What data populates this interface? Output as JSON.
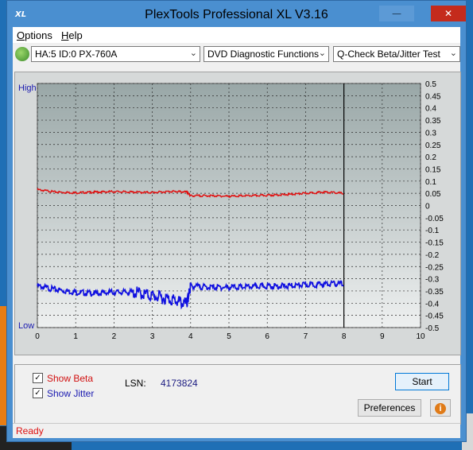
{
  "window": {
    "title": "PlexTools Professional XL V3.16",
    "app_icon_text": "XL"
  },
  "menu": {
    "items": [
      "Options",
      "Help"
    ]
  },
  "toolbar": {
    "drive": "HA:5 ID:0  PX-760A",
    "function": "DVD Diagnostic Functions",
    "test": "Q-Check Beta/Jitter Test"
  },
  "graph": {
    "high_label": "High",
    "low_label": "Low",
    "colors": {
      "plot_top": "#99a7a7",
      "plot_bottom": "#eef0f0",
      "beta": "#e01010",
      "jitter": "#1010e0",
      "grid": "#2a2a2a"
    }
  },
  "chart_data": {
    "type": "line",
    "x_ticks": [
      "0",
      "1",
      "2",
      "3",
      "4",
      "5",
      "6",
      "7",
      "8",
      "9",
      "10"
    ],
    "y_right_ticks": [
      "0.5",
      "0.45",
      "0.4",
      "0.35",
      "0.3",
      "0.25",
      "0.2",
      "0.15",
      "0.1",
      "0.05",
      "0",
      "-0.05",
      "-0.1",
      "-0.15",
      "-0.2",
      "-0.25",
      "-0.3",
      "-0.35",
      "-0.4",
      "-0.45",
      "-0.5"
    ],
    "xlim": [
      0,
      10
    ],
    "ylim": [
      -0.5,
      0.5
    ],
    "grid": true,
    "end_marker_x": 8,
    "series": [
      {
        "color": "#e01010",
        "x": [
          0,
          0.5,
          1,
          1.5,
          2,
          2.5,
          3,
          3.5,
          3.9,
          4.0,
          4.5,
          5,
          5.5,
          6,
          6.5,
          7,
          7.5,
          8
        ],
        "y": [
          0.065,
          0.055,
          0.052,
          0.055,
          0.057,
          0.055,
          0.053,
          0.058,
          0.055,
          0.04,
          0.04,
          0.038,
          0.04,
          0.042,
          0.045,
          0.05,
          0.055,
          0.05
        ]
      },
      {
        "color": "#1010e0",
        "x": [
          0,
          0.5,
          1,
          1.5,
          2,
          2.5,
          3,
          3.5,
          3.9,
          4.0,
          4.5,
          5,
          5.5,
          6,
          6.5,
          7,
          7.5,
          8
        ],
        "y": [
          -0.33,
          -0.345,
          -0.355,
          -0.36,
          -0.355,
          -0.355,
          -0.37,
          -0.385,
          -0.405,
          -0.33,
          -0.335,
          -0.335,
          -0.333,
          -0.33,
          -0.33,
          -0.325,
          -0.322,
          -0.32
        ]
      }
    ]
  },
  "controls": {
    "show_beta": "Show Beta",
    "show_jitter": "Show Jitter",
    "beta_color": "#d11111",
    "jitter_color": "#1a1ab0",
    "lsn_label": "LSN:",
    "lsn_value": "4173824",
    "start": "Start",
    "preferences": "Preferences",
    "info": "i"
  },
  "status": {
    "text": "Ready"
  }
}
